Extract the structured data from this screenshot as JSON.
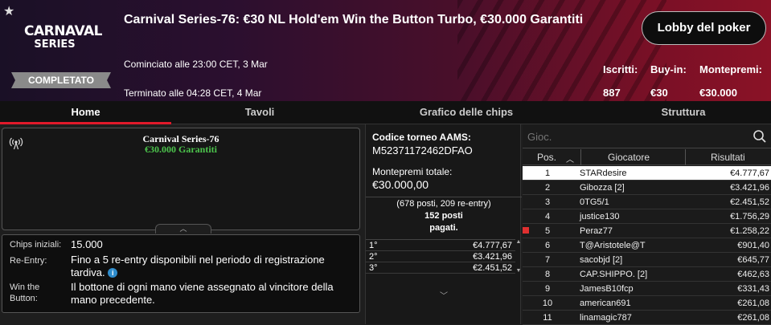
{
  "header": {
    "logo_line1": "CARNAVAL",
    "logo_line2": "SERIES",
    "status_badge": "COMPLETATO",
    "title": "Carnival Series-76: €30 NL Hold'em Win the Button Turbo, €30.000 Garantiti",
    "started": "Cominciato alle 23:00 CET, 3 Mar",
    "ended": "Terminato alle 04:28 CET, 4 Mar",
    "lobby_button": "Lobby del poker",
    "stats": {
      "entrants_label": "Iscritti:",
      "entrants_value": "887",
      "buyin_label": "Buy-in:",
      "buyin_value": "€30",
      "prize_label": "Montepremi:",
      "prize_value": "€30.000"
    }
  },
  "tabs": [
    "Home",
    "Tavoli",
    "Grafico delle chips",
    "Struttura"
  ],
  "promo": {
    "line1": "Carnival Series-76",
    "line2": "€30.000 Garantiti"
  },
  "info": {
    "chips_label": "Chips iniziali:",
    "chips_value": "15.000",
    "reentry_label": "Re-Entry:",
    "reentry_value": "Fino a 5 re-entry disponibili nel periodo di registrazione tardiva.",
    "wtb_label_1": "Win the",
    "wtb_label_2": "Button:",
    "wtb_value": "Il bottone di ogni mano viene assegnato al vincitore della mano precedente."
  },
  "middle": {
    "aams_label": "Codice torneo AAMS:",
    "aams_value": "M52371172462DFAO",
    "prize_label": "Montepremi totale:",
    "prize_value": "€30.000,00",
    "places_line1": "(678 posti, 209 re-entry)",
    "places_line2": "152 posti",
    "places_line3": "pagati.",
    "payouts": [
      {
        "place": "1°",
        "amount": "€4.777,67"
      },
      {
        "place": "2°",
        "amount": "€3.421,96"
      },
      {
        "place": "3°",
        "amount": "€2.451,52"
      }
    ]
  },
  "players": {
    "search_placeholder": "Gioc.",
    "col_pos": "Pos.",
    "col_player": "Giocatore",
    "col_result": "Risultati",
    "rows": [
      {
        "pos": "1",
        "name": "STARdesire",
        "result": "€4.777,67"
      },
      {
        "pos": "2",
        "name": "Gibozza [2]",
        "result": "€3.421,96"
      },
      {
        "pos": "3",
        "name": "0TG5/1",
        "result": "€2.451,52"
      },
      {
        "pos": "4",
        "name": "justice130",
        "result": "€1.756,29"
      },
      {
        "pos": "5",
        "name": "Peraz77",
        "result": "€1.258,22"
      },
      {
        "pos": "6",
        "name": "T@Aristotele@T",
        "result": "€901,40"
      },
      {
        "pos": "7",
        "name": "sacobjd [2]",
        "result": "€645,77"
      },
      {
        "pos": "8",
        "name": "CAP.SHIPPO. [2]",
        "result": "€462,63"
      },
      {
        "pos": "9",
        "name": "JamesB10fcp",
        "result": "€331,43"
      },
      {
        "pos": "10",
        "name": "american691",
        "result": "€261,08"
      },
      {
        "pos": "11",
        "name": "linamagic787",
        "result": "€261,08"
      }
    ]
  },
  "colors": {
    "accent_red": "#e0192a",
    "promo_green": "#4cc44c",
    "info_blue": "#2f8ccc"
  }
}
